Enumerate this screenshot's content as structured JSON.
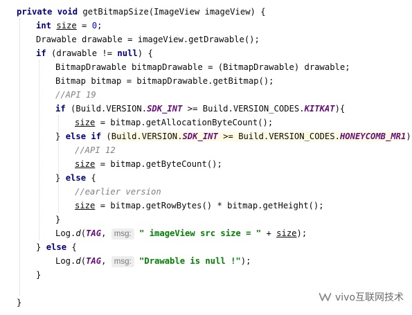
{
  "code": {
    "lines": [
      {
        "indent": 0,
        "tokens": [
          {
            "t": "private void ",
            "c": "kw"
          },
          {
            "t": "getBitmapSize(ImageView imageView) {"
          }
        ]
      },
      {
        "indent": 1,
        "tokens": [
          {
            "t": "int ",
            "c": "kw"
          },
          {
            "t": "size",
            "c": "ul"
          },
          {
            "t": " = "
          },
          {
            "t": "0",
            "c": "num"
          },
          {
            "t": ";"
          }
        ]
      },
      {
        "indent": 1,
        "tokens": [
          {
            "t": "Drawable drawable = imageView.getDrawable();"
          }
        ]
      },
      {
        "indent": 1,
        "tokens": [
          {
            "t": "if ",
            "c": "kw"
          },
          {
            "t": "(drawable != "
          },
          {
            "t": "null",
            "c": "kw"
          },
          {
            "t": ") {"
          }
        ]
      },
      {
        "indent": 2,
        "tokens": [
          {
            "t": "BitmapDrawable bitmapDrawable = (BitmapDrawable) drawable;"
          }
        ]
      },
      {
        "indent": 2,
        "tokens": [
          {
            "t": "Bitmap bitmap = bitmapDrawable.getBitmap();"
          }
        ]
      },
      {
        "indent": 2,
        "tokens": [
          {
            "t": "//API 19",
            "c": "cmt"
          }
        ]
      },
      {
        "indent": 2,
        "tokens": [
          {
            "t": "if ",
            "c": "kw"
          },
          {
            "t": "(Build.VERSION."
          },
          {
            "t": "SDK_INT",
            "c": "ital-purple"
          },
          {
            "t": " >= Build.VERSION_CODES."
          },
          {
            "t": "KITKAT",
            "c": "ital-purple"
          },
          {
            "t": "){"
          }
        ]
      },
      {
        "indent": 3,
        "tokens": [
          {
            "t": "size",
            "c": "ul"
          },
          {
            "t": " = bitmap.getAllocationByteCount();"
          }
        ]
      },
      {
        "indent": 2,
        "tokens": [
          {
            "t": "} "
          },
          {
            "t": "else if ",
            "c": "kw"
          },
          {
            "t": "("
          },
          {
            "t": "Build.VERSION.",
            "c": "hl"
          },
          {
            "t": "SDK_INT",
            "c": "ital-purple hl"
          },
          {
            "t": " >= Build.VERSION_CODES.",
            "c": "hl"
          },
          {
            "t": "HONEYCOMB_MR1",
            "c": "ital-purple hl"
          },
          {
            "t": "){"
          }
        ]
      },
      {
        "indent": 3,
        "tokens": [
          {
            "t": "//API 12",
            "c": "cmt"
          }
        ]
      },
      {
        "indent": 3,
        "tokens": [
          {
            "t": "size",
            "c": "ul"
          },
          {
            "t": " = bitmap.getByteCount();"
          }
        ]
      },
      {
        "indent": 2,
        "tokens": [
          {
            "t": "} "
          },
          {
            "t": "else ",
            "c": "kw"
          },
          {
            "t": "{"
          }
        ]
      },
      {
        "indent": 3,
        "tokens": [
          {
            "t": "//earlier version",
            "c": "cmt"
          }
        ]
      },
      {
        "indent": 3,
        "tokens": [
          {
            "t": "size",
            "c": "ul"
          },
          {
            "t": " = bitmap.getRowBytes() * bitmap.getHeight();"
          }
        ]
      },
      {
        "indent": 2,
        "tokens": [
          {
            "t": "}"
          }
        ]
      },
      {
        "indent": 2,
        "tokens": [
          {
            "t": "Log."
          },
          {
            "t": "d",
            "c": "ital-fn"
          },
          {
            "t": "("
          },
          {
            "t": "TAG",
            "c": "ital-purple"
          },
          {
            "t": ", "
          },
          {
            "t": "msg:",
            "c": "hint"
          },
          {
            "t": " "
          },
          {
            "t": "\" imageView src size = \"",
            "c": "str"
          },
          {
            "t": " + "
          },
          {
            "t": "size",
            "c": "ul"
          },
          {
            "t": ");"
          }
        ]
      },
      {
        "indent": 1,
        "tokens": [
          {
            "t": "} "
          },
          {
            "t": "else ",
            "c": "kw"
          },
          {
            "t": "{"
          }
        ]
      },
      {
        "indent": 2,
        "tokens": [
          {
            "t": "Log."
          },
          {
            "t": "d",
            "c": "ital-fn"
          },
          {
            "t": "("
          },
          {
            "t": "TAG",
            "c": "ital-purple"
          },
          {
            "t": ", "
          },
          {
            "t": "msg:",
            "c": "hint"
          },
          {
            "t": " "
          },
          {
            "t": "\"Drawable is null !\"",
            "c": "str"
          },
          {
            "t": ");"
          }
        ]
      },
      {
        "indent": 1,
        "tokens": [
          {
            "t": "}"
          }
        ]
      },
      {
        "indent": 0,
        "tokens": []
      },
      {
        "indent": 0,
        "tokens": [
          {
            "t": "}"
          }
        ]
      }
    ]
  },
  "watermark": {
    "icon": "wechat-channel-icon",
    "text": "vivo互联网技术"
  }
}
